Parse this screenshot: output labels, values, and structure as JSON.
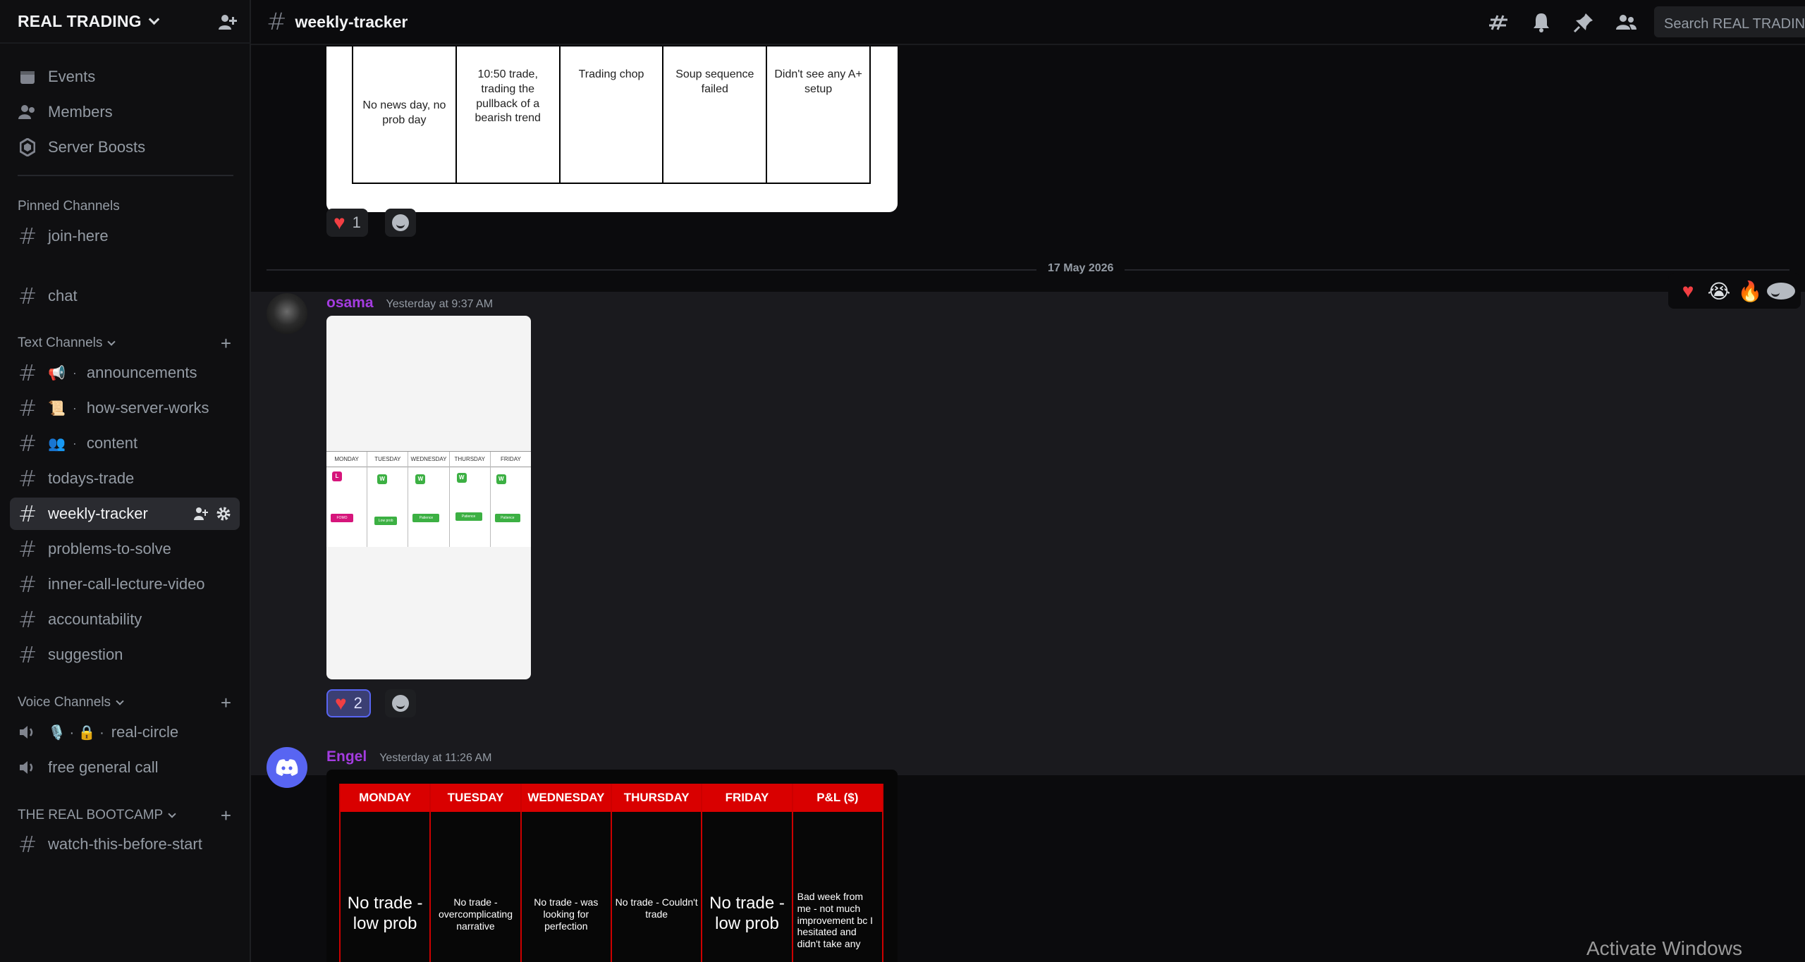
{
  "server": {
    "name": "REAL TRADING"
  },
  "top_items": [
    {
      "label": "Events",
      "icon": "calendar-icon"
    },
    {
      "label": "Members",
      "icon": "members-icon"
    },
    {
      "label": "Server Boosts",
      "icon": "boost-icon"
    }
  ],
  "pinned": {
    "title": "Pinned Channels",
    "channels": [
      "join-here"
    ]
  },
  "loose_channels": [
    "chat"
  ],
  "text_channels": {
    "title": "Text Channels",
    "channels": [
      {
        "name": "announcements",
        "emoji": "📢"
      },
      {
        "name": "how-server-works",
        "emoji": "📜"
      },
      {
        "name": "content",
        "emoji": "👥"
      },
      {
        "name": "todays-trade",
        "emoji": ""
      },
      {
        "name": "weekly-tracker",
        "emoji": ""
      },
      {
        "name": "problems-to-solve",
        "emoji": ""
      },
      {
        "name": "inner-call-lecture-video",
        "emoji": ""
      },
      {
        "name": "accountability",
        "emoji": ""
      },
      {
        "name": "suggestion",
        "emoji": ""
      }
    ]
  },
  "voice_channels": {
    "title": "Voice Channels",
    "channels": [
      {
        "name": "real-circle",
        "emojis": "🎙️ · 🔒 ·"
      },
      {
        "name": "free general call"
      }
    ]
  },
  "bootcamp": {
    "title": "THE REAL BOOTCAMP",
    "channels": [
      "watch-this-before-start"
    ]
  },
  "topbar": {
    "channel": "weekly-tracker",
    "search_placeholder": "Search REAL TRADING"
  },
  "first_embed": {
    "cells": [
      "No news day, no prob day",
      "10:50 trade, trading the pullback of a bearish trend",
      "Trading chop",
      "Soup sequence failed",
      "Didn't see any A+ setup"
    ],
    "reaction_count": "1"
  },
  "date_divider": "17 May 2026",
  "msg_osama": {
    "user": "osama",
    "user_color": "#a43ce0",
    "time": "Yesterday at 9:37 AM",
    "reaction_count": "2",
    "tracker": {
      "days": [
        "MONDAY",
        "TUESDAY",
        "WEDNESDAY",
        "THURSDAY",
        "FRIDAY"
      ],
      "results": [
        "L",
        "W",
        "W",
        "W",
        "W"
      ],
      "notes": [
        "FOMO",
        "Low prob",
        "Patience",
        "Patience",
        "Patience"
      ]
    }
  },
  "msg_engel": {
    "user": "Engel",
    "user_color": "#a43ce0",
    "time": "Yesterday at 11:26 AM",
    "headers": [
      "MONDAY",
      "TUESDAY",
      "WEDNESDAY",
      "THURSDAY",
      "FRIDAY",
      "P&L ($)"
    ],
    "cells": [
      "No trade - low prob",
      "No trade - overcomplicating narrative",
      "No trade - was looking for perfection",
      "No trade - Couldn't trade",
      "No trade - low prob",
      "Bad week from me - not much improvement bc I hesitated and didn't take any"
    ]
  },
  "watermark": "Activate Windows"
}
